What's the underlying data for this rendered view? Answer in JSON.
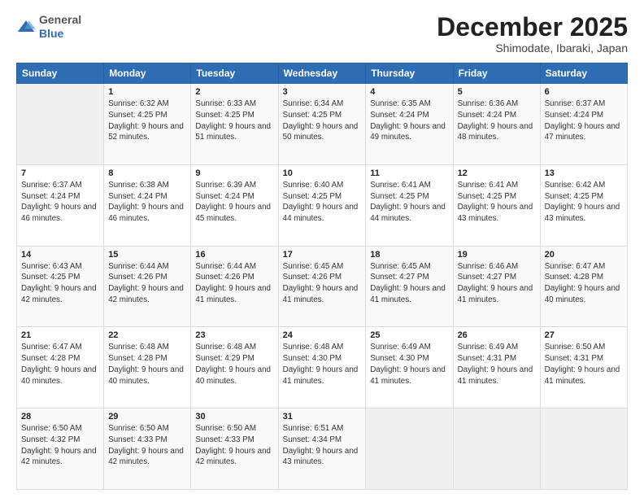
{
  "header": {
    "logo": {
      "general": "General",
      "blue": "Blue"
    },
    "title": "December 2025",
    "location": "Shimodate, Ibaraki, Japan"
  },
  "calendar": {
    "days_of_week": [
      "Sunday",
      "Monday",
      "Tuesday",
      "Wednesday",
      "Thursday",
      "Friday",
      "Saturday"
    ],
    "weeks": [
      [
        {
          "day": "",
          "sunrise": "",
          "sunset": "",
          "daylight": ""
        },
        {
          "day": "1",
          "sunrise": "6:32 AM",
          "sunset": "4:25 PM",
          "daylight": "9 hours and 52 minutes."
        },
        {
          "day": "2",
          "sunrise": "6:33 AM",
          "sunset": "4:25 PM",
          "daylight": "9 hours and 51 minutes."
        },
        {
          "day": "3",
          "sunrise": "6:34 AM",
          "sunset": "4:25 PM",
          "daylight": "9 hours and 50 minutes."
        },
        {
          "day": "4",
          "sunrise": "6:35 AM",
          "sunset": "4:24 PM",
          "daylight": "9 hours and 49 minutes."
        },
        {
          "day": "5",
          "sunrise": "6:36 AM",
          "sunset": "4:24 PM",
          "daylight": "9 hours and 48 minutes."
        },
        {
          "day": "6",
          "sunrise": "6:37 AM",
          "sunset": "4:24 PM",
          "daylight": "9 hours and 47 minutes."
        }
      ],
      [
        {
          "day": "7",
          "sunrise": "6:37 AM",
          "sunset": "4:24 PM",
          "daylight": "9 hours and 46 minutes."
        },
        {
          "day": "8",
          "sunrise": "6:38 AM",
          "sunset": "4:24 PM",
          "daylight": "9 hours and 46 minutes."
        },
        {
          "day": "9",
          "sunrise": "6:39 AM",
          "sunset": "4:24 PM",
          "daylight": "9 hours and 45 minutes."
        },
        {
          "day": "10",
          "sunrise": "6:40 AM",
          "sunset": "4:25 PM",
          "daylight": "9 hours and 44 minutes."
        },
        {
          "day": "11",
          "sunrise": "6:41 AM",
          "sunset": "4:25 PM",
          "daylight": "9 hours and 44 minutes."
        },
        {
          "day": "12",
          "sunrise": "6:41 AM",
          "sunset": "4:25 PM",
          "daylight": "9 hours and 43 minutes."
        },
        {
          "day": "13",
          "sunrise": "6:42 AM",
          "sunset": "4:25 PM",
          "daylight": "9 hours and 43 minutes."
        }
      ],
      [
        {
          "day": "14",
          "sunrise": "6:43 AM",
          "sunset": "4:25 PM",
          "daylight": "9 hours and 42 minutes."
        },
        {
          "day": "15",
          "sunrise": "6:44 AM",
          "sunset": "4:26 PM",
          "daylight": "9 hours and 42 minutes."
        },
        {
          "day": "16",
          "sunrise": "6:44 AM",
          "sunset": "4:26 PM",
          "daylight": "9 hours and 41 minutes."
        },
        {
          "day": "17",
          "sunrise": "6:45 AM",
          "sunset": "4:26 PM",
          "daylight": "9 hours and 41 minutes."
        },
        {
          "day": "18",
          "sunrise": "6:45 AM",
          "sunset": "4:27 PM",
          "daylight": "9 hours and 41 minutes."
        },
        {
          "day": "19",
          "sunrise": "6:46 AM",
          "sunset": "4:27 PM",
          "daylight": "9 hours and 41 minutes."
        },
        {
          "day": "20",
          "sunrise": "6:47 AM",
          "sunset": "4:28 PM",
          "daylight": "9 hours and 40 minutes."
        }
      ],
      [
        {
          "day": "21",
          "sunrise": "6:47 AM",
          "sunset": "4:28 PM",
          "daylight": "9 hours and 40 minutes."
        },
        {
          "day": "22",
          "sunrise": "6:48 AM",
          "sunset": "4:28 PM",
          "daylight": "9 hours and 40 minutes."
        },
        {
          "day": "23",
          "sunrise": "6:48 AM",
          "sunset": "4:29 PM",
          "daylight": "9 hours and 40 minutes."
        },
        {
          "day": "24",
          "sunrise": "6:48 AM",
          "sunset": "4:30 PM",
          "daylight": "9 hours and 41 minutes."
        },
        {
          "day": "25",
          "sunrise": "6:49 AM",
          "sunset": "4:30 PM",
          "daylight": "9 hours and 41 minutes."
        },
        {
          "day": "26",
          "sunrise": "6:49 AM",
          "sunset": "4:31 PM",
          "daylight": "9 hours and 41 minutes."
        },
        {
          "day": "27",
          "sunrise": "6:50 AM",
          "sunset": "4:31 PM",
          "daylight": "9 hours and 41 minutes."
        }
      ],
      [
        {
          "day": "28",
          "sunrise": "6:50 AM",
          "sunset": "4:32 PM",
          "daylight": "9 hours and 42 minutes."
        },
        {
          "day": "29",
          "sunrise": "6:50 AM",
          "sunset": "4:33 PM",
          "daylight": "9 hours and 42 minutes."
        },
        {
          "day": "30",
          "sunrise": "6:50 AM",
          "sunset": "4:33 PM",
          "daylight": "9 hours and 42 minutes."
        },
        {
          "day": "31",
          "sunrise": "6:51 AM",
          "sunset": "4:34 PM",
          "daylight": "9 hours and 43 minutes."
        },
        {
          "day": "",
          "sunrise": "",
          "sunset": "",
          "daylight": ""
        },
        {
          "day": "",
          "sunrise": "",
          "sunset": "",
          "daylight": ""
        },
        {
          "day": "",
          "sunrise": "",
          "sunset": "",
          "daylight": ""
        }
      ]
    ]
  }
}
